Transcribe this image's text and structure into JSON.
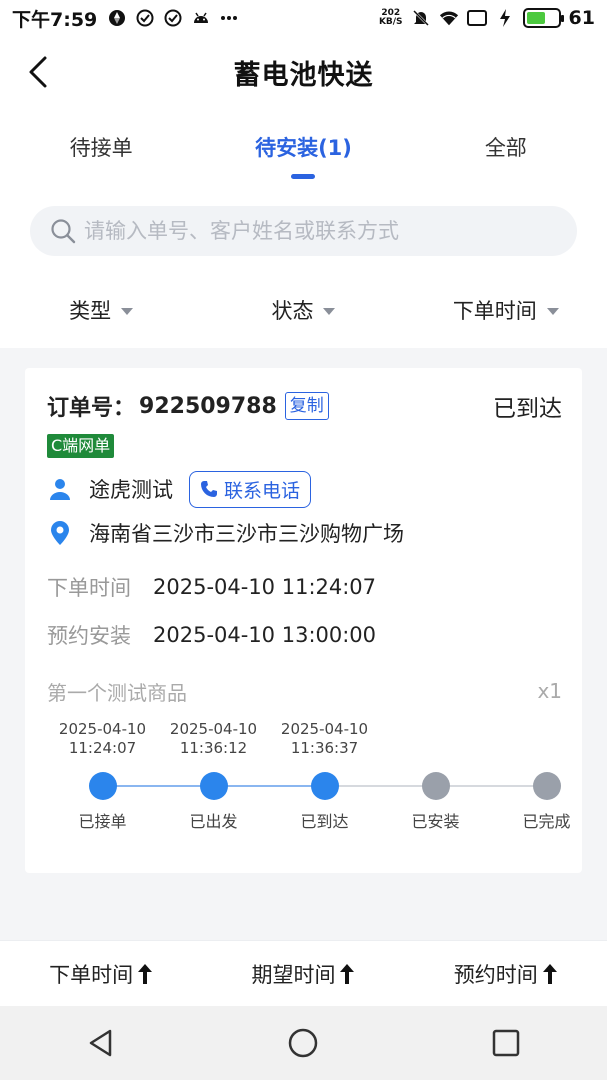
{
  "status_bar": {
    "time": "下午7:59",
    "net_speed_value": "202",
    "net_speed_unit": "KB/S",
    "battery_level": "61",
    "battery_fraction": 0.61
  },
  "header": {
    "title": "蓄电池快送"
  },
  "tabs": [
    {
      "label": "待接单",
      "active": false
    },
    {
      "label": "待安装(1)",
      "active": true
    },
    {
      "label": "全部",
      "active": false
    }
  ],
  "search": {
    "placeholder": "请输入单号、客户姓名或联系方式",
    "value": ""
  },
  "filters": [
    {
      "label": "类型"
    },
    {
      "label": "状态"
    },
    {
      "label": "下单时间"
    }
  ],
  "order": {
    "order_label": "订单号：",
    "order_no": "922509788",
    "copy_label": "复制",
    "status": "已到达",
    "tag": "C端网单",
    "customer_name": "途虎测试",
    "call_label": "联系电话",
    "address": "海南省三沙市三沙市三沙购物广场",
    "order_time_label": "下单时间",
    "order_time": "2025-04-10 11:24:07",
    "install_time_label": "预约安装",
    "install_time": "2025-04-10 13:00:00",
    "goods_name": "第一个测试商品",
    "goods_qty": "x1",
    "timeline": [
      {
        "label": "已接单",
        "date": "2025-04-10",
        "time": "11:24:07",
        "done": true
      },
      {
        "label": "已出发",
        "date": "2025-04-10",
        "time": "11:36:12",
        "done": true
      },
      {
        "label": "已到达",
        "date": "2025-04-10",
        "time": "11:36:37",
        "done": true
      },
      {
        "label": "已安装",
        "date": "",
        "time": "",
        "done": false
      },
      {
        "label": "已完成",
        "date": "",
        "time": "",
        "done": false
      }
    ]
  },
  "sort_bar": [
    {
      "label": "下单时间"
    },
    {
      "label": "期望时间"
    },
    {
      "label": "预约时间"
    }
  ],
  "colors": {
    "accent": "#2b63e0",
    "timeline_done": "#2b85ec",
    "timeline_todo": "#9aa0aa",
    "tag_green": "#1f8a3a"
  },
  "icons": {
    "back": "chevron-left-icon",
    "search": "search-icon",
    "person": "person-icon",
    "location": "location-pin-icon",
    "phone": "phone-icon",
    "sort_arrow": "arrow-up-icon",
    "nav_back": "triangle-back-icon",
    "nav_home": "circle-home-icon",
    "nav_recent": "square-recent-icon"
  }
}
